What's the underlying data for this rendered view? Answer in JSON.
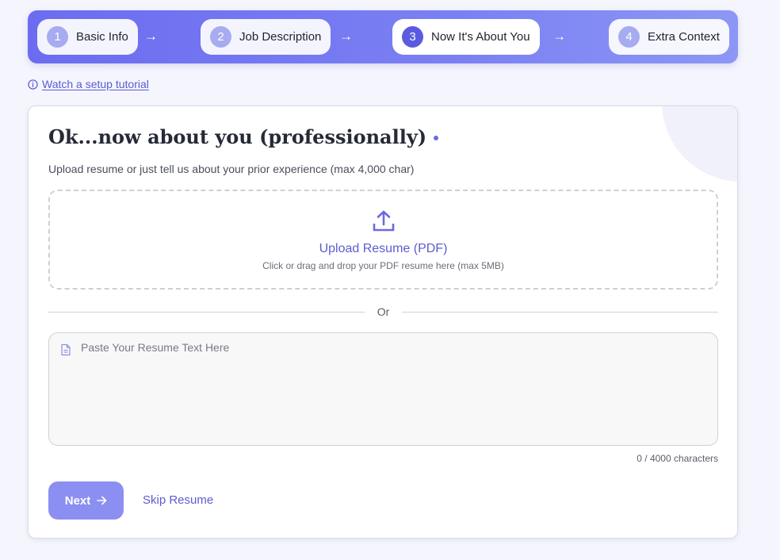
{
  "stepper": {
    "steps": [
      {
        "number": "1",
        "label": "Basic Info",
        "state": "complete"
      },
      {
        "number": "2",
        "label": "Job Description",
        "state": "complete"
      },
      {
        "number": "3",
        "label": "Now It's About You",
        "state": "active"
      },
      {
        "number": "4",
        "label": "Extra Context",
        "state": "upcoming"
      }
    ],
    "arrow": "→"
  },
  "tutorial": {
    "label": "Watch a setup tutorial",
    "icon": "info-icon"
  },
  "card": {
    "title": "Ok...now about you (professionally)",
    "subtitle": "Upload resume or just tell us about your prior experience (max 4,000 char)",
    "upload": {
      "icon": "upload-icon",
      "title": "Upload Resume (PDF)",
      "hint": "Click or drag and drop your PDF resume here (max 5MB)"
    },
    "divider_label": "Or",
    "resume_text": {
      "icon": "document-icon",
      "placeholder": "Paste Your Resume Text Here",
      "value": ""
    },
    "counter": "0 / 4000 characters",
    "next_label": "Next",
    "skip_label": "Skip Resume"
  },
  "colors": {
    "accent": "#5b5be0",
    "stepper_start": "#6c6cf0",
    "stepper_end": "#8c97f5",
    "next_button": "#8b8ff2",
    "link": "#5c5cd0"
  }
}
